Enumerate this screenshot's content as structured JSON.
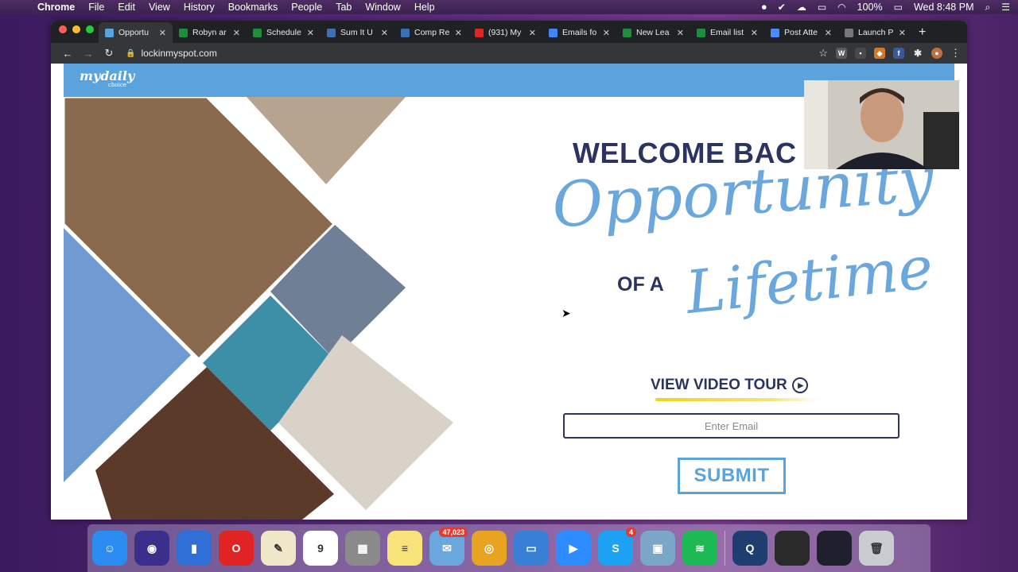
{
  "menubar": {
    "app": "Chrome",
    "items": [
      "File",
      "Edit",
      "View",
      "History",
      "Bookmarks",
      "People",
      "Tab",
      "Window",
      "Help"
    ],
    "battery": "100%",
    "clock": "Wed 8:48 PM"
  },
  "browser": {
    "tabs": [
      {
        "label": "Opportu",
        "favicon_color": "#5ba3dc",
        "active": true
      },
      {
        "label": "Robyn ar",
        "favicon_color": "#1e8e3e",
        "active": false
      },
      {
        "label": "Schedule",
        "favicon_color": "#1e8e3e",
        "active": false
      },
      {
        "label": "Sum It U",
        "favicon_color": "#3c6fb4",
        "active": false
      },
      {
        "label": "Comp Re",
        "favicon_color": "#3c6fb4",
        "active": false
      },
      {
        "label": "(931) My",
        "favicon_color": "#e02424",
        "active": false
      },
      {
        "label": "Emails fo",
        "favicon_color": "#4285f4",
        "active": false
      },
      {
        "label": "New Lea",
        "favicon_color": "#1e8e3e",
        "active": false
      },
      {
        "label": "Email list",
        "favicon_color": "#1e8e3e",
        "active": false
      },
      {
        "label": "Post Atte",
        "favicon_color": "#4a8cff",
        "active": false
      },
      {
        "label": "Launch P",
        "favicon_color": "#777777",
        "active": false
      }
    ],
    "url": "lockinmyspot.com"
  },
  "page": {
    "logo": "mydaily",
    "logo_sub": "choice",
    "welcome": "WELCOME BAC",
    "script_1": "Opportunity",
    "of_a": "OF A",
    "script_2": "Lifetime",
    "video_tour": "VIEW VIDEO TOUR",
    "email_placeholder": "Enter Email",
    "submit": "SUBMIT"
  },
  "dock": {
    "apps": [
      {
        "name": "finder",
        "color": "#2a8cf0",
        "glyph": "☺"
      },
      {
        "name": "siri",
        "color": "#3a2f8a",
        "glyph": "◉"
      },
      {
        "name": "numbers",
        "color": "#2f6fd6",
        "glyph": "▮"
      },
      {
        "name": "opera",
        "color": "#e02424",
        "glyph": "O"
      },
      {
        "name": "textedit",
        "color": "#f0e6c8",
        "glyph": "✎"
      },
      {
        "name": "calendar",
        "color": "#ffffff",
        "glyph": "9"
      },
      {
        "name": "calculator",
        "color": "#8a8a8a",
        "glyph": "▦"
      },
      {
        "name": "notes",
        "color": "#f7e37a",
        "glyph": "≡"
      },
      {
        "name": "mail",
        "color": "#6aa7dc",
        "glyph": "✉",
        "badge": "47,023"
      },
      {
        "name": "chrome",
        "color": "#e8a321",
        "glyph": "◎"
      },
      {
        "name": "keynote",
        "color": "#3a7fd6",
        "glyph": "▭"
      },
      {
        "name": "zoom",
        "color": "#2d8cff",
        "glyph": "▶"
      },
      {
        "name": "skype",
        "color": "#1da1f2",
        "glyph": "S",
        "badge": "4"
      },
      {
        "name": "preview",
        "color": "#7aa7c7",
        "glyph": "▣"
      },
      {
        "name": "spotify",
        "color": "#1db954",
        "glyph": "≋"
      },
      {
        "name": "quicktime",
        "color": "#1f3d6e",
        "glyph": "Q"
      },
      {
        "name": "window-thumb-1",
        "color": "#2a2a2a",
        "glyph": ""
      },
      {
        "name": "window-thumb-2",
        "color": "#1f1f2e",
        "glyph": ""
      },
      {
        "name": "trash",
        "color": "#c9ccd1",
        "glyph": "🗑"
      }
    ]
  }
}
